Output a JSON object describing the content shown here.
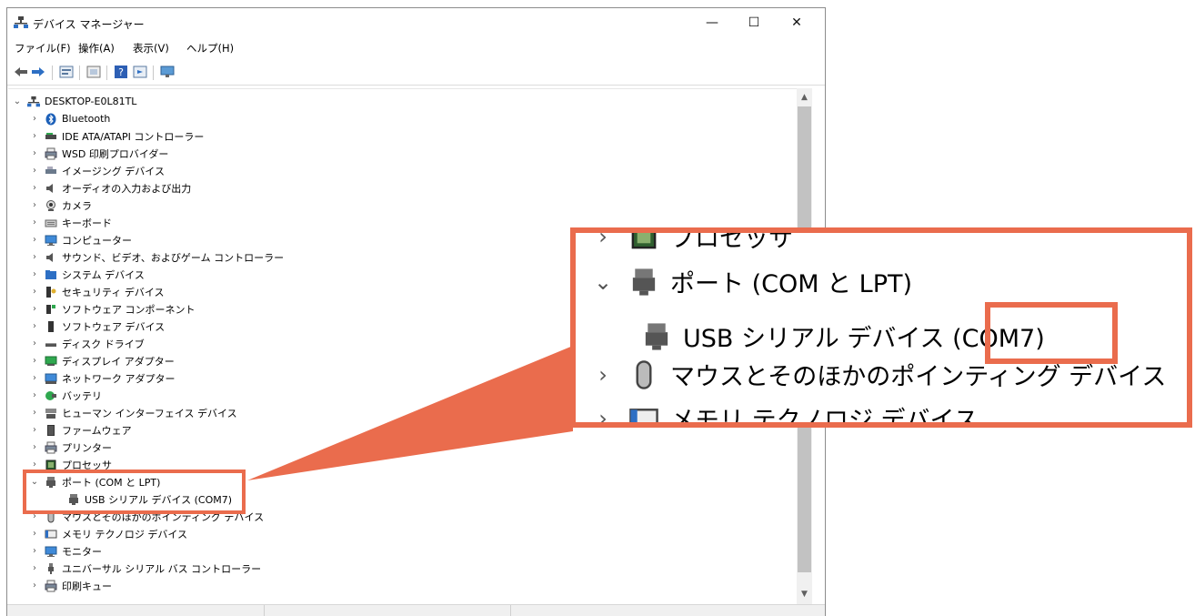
{
  "window": {
    "title": "デバイス マネージャー",
    "controls": {
      "minimize": "—",
      "maximize": "☐",
      "close": "✕"
    }
  },
  "menu": [
    "ファイル(F)",
    "操作(A)",
    "表示(V)",
    "ヘルプ(H)"
  ],
  "tree": {
    "root": "DESKTOP-E0L81TL",
    "items": [
      {
        "label": "Bluetooth",
        "icon": "bluetooth-icon"
      },
      {
        "label": "IDE ATA/ATAPI コントローラー",
        "icon": "ide-controller-icon"
      },
      {
        "label": "WSD 印刷プロバイダー",
        "icon": "printer-icon"
      },
      {
        "label": "イメージング デバイス",
        "icon": "camera-device-icon"
      },
      {
        "label": "オーディオの入力および出力",
        "icon": "speaker-icon"
      },
      {
        "label": "カメラ",
        "icon": "webcam-icon"
      },
      {
        "label": "キーボード",
        "icon": "keyboard-icon"
      },
      {
        "label": "コンピューター",
        "icon": "monitor-icon"
      },
      {
        "label": "サウンド、ビデオ、およびゲーム コントローラー",
        "icon": "speaker-icon"
      },
      {
        "label": "システム デバイス",
        "icon": "folder-icon"
      },
      {
        "label": "セキュリティ デバイス",
        "icon": "key-icon"
      },
      {
        "label": "ソフトウェア コンポーネント",
        "icon": "component-icon"
      },
      {
        "label": "ソフトウェア デバイス",
        "icon": "device-icon"
      },
      {
        "label": "ディスク ドライブ",
        "icon": "disk-icon"
      },
      {
        "label": "ディスプレイ アダプター",
        "icon": "display-adapter-icon"
      },
      {
        "label": "ネットワーク アダプター",
        "icon": "network-icon"
      },
      {
        "label": "バッテリ",
        "icon": "battery-icon"
      },
      {
        "label": "ヒューマン インターフェイス デバイス",
        "icon": "hid-icon"
      },
      {
        "label": "ファームウェア",
        "icon": "chip-icon"
      },
      {
        "label": "プリンター",
        "icon": "printer-icon"
      },
      {
        "label": "プロセッサ",
        "icon": "processor-icon"
      },
      {
        "label": "ポート (COM と LPT)",
        "icon": "port-icon",
        "expanded": true
      },
      {
        "label": "USB シリアル デバイス (COM7)",
        "icon": "port-icon",
        "child": true
      },
      {
        "label": "マウスとそのほかのポインティング デバイス",
        "icon": "mouse-icon"
      },
      {
        "label": "メモリ テクノロジ デバイス",
        "icon": "memory-icon"
      },
      {
        "label": "モニター",
        "icon": "monitor-icon"
      },
      {
        "label": "ユニバーサル シリアル バス コントローラー",
        "icon": "usb-icon"
      },
      {
        "label": "印刷キュー",
        "icon": "printer-icon"
      }
    ]
  },
  "zoom": {
    "rows": [
      {
        "label": "プロセッサ",
        "chevron": "›"
      },
      {
        "label": "ポート (COM と LPT)",
        "chevron": "⌄"
      },
      {
        "label": "USB シリアル デバイス (COM7)",
        "chevron": ""
      },
      {
        "label": "マウスとそのほかのポインティング デバイス",
        "chevron": "›"
      },
      {
        "label": "メモリ テクノロジ デバイス",
        "chevron": "›"
      }
    ]
  },
  "colors": {
    "highlight": "#ea6c4d",
    "scroll_thumb": "#c2c2c2"
  }
}
